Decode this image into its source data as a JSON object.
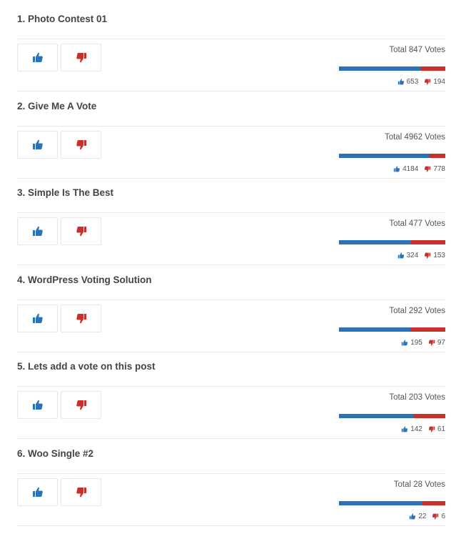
{
  "colors": {
    "up": "#2a73b8",
    "down": "#c9302c"
  },
  "icons": {
    "up": "thumbs-up-icon",
    "down": "thumbs-down-icon"
  },
  "items": [
    {
      "title": "1. Photo Contest 01",
      "total": "Total 847 Votes",
      "up": "653",
      "down": "194",
      "up_share": 0.771
    },
    {
      "title": "2. Give Me A Vote",
      "total": "Total 4962 Votes",
      "up": "4184",
      "down": "778",
      "up_share": 0.843
    },
    {
      "title": "3. Simple Is The Best",
      "total": "Total 477 Votes",
      "up": "324",
      "down": "153",
      "up_share": 0.679
    },
    {
      "title": "4. WordPress Voting Solution",
      "total": "Total 292 Votes",
      "up": "195",
      "down": "97",
      "up_share": 0.668
    },
    {
      "title": "5. Lets add a vote on this post",
      "total": "Total 203 Votes",
      "up": "142",
      "down": "61",
      "up_share": 0.7
    },
    {
      "title": "6. Woo Single #2",
      "total": "Total 28 Votes",
      "up": "22",
      "down": "6",
      "up_share": 0.786
    }
  ]
}
